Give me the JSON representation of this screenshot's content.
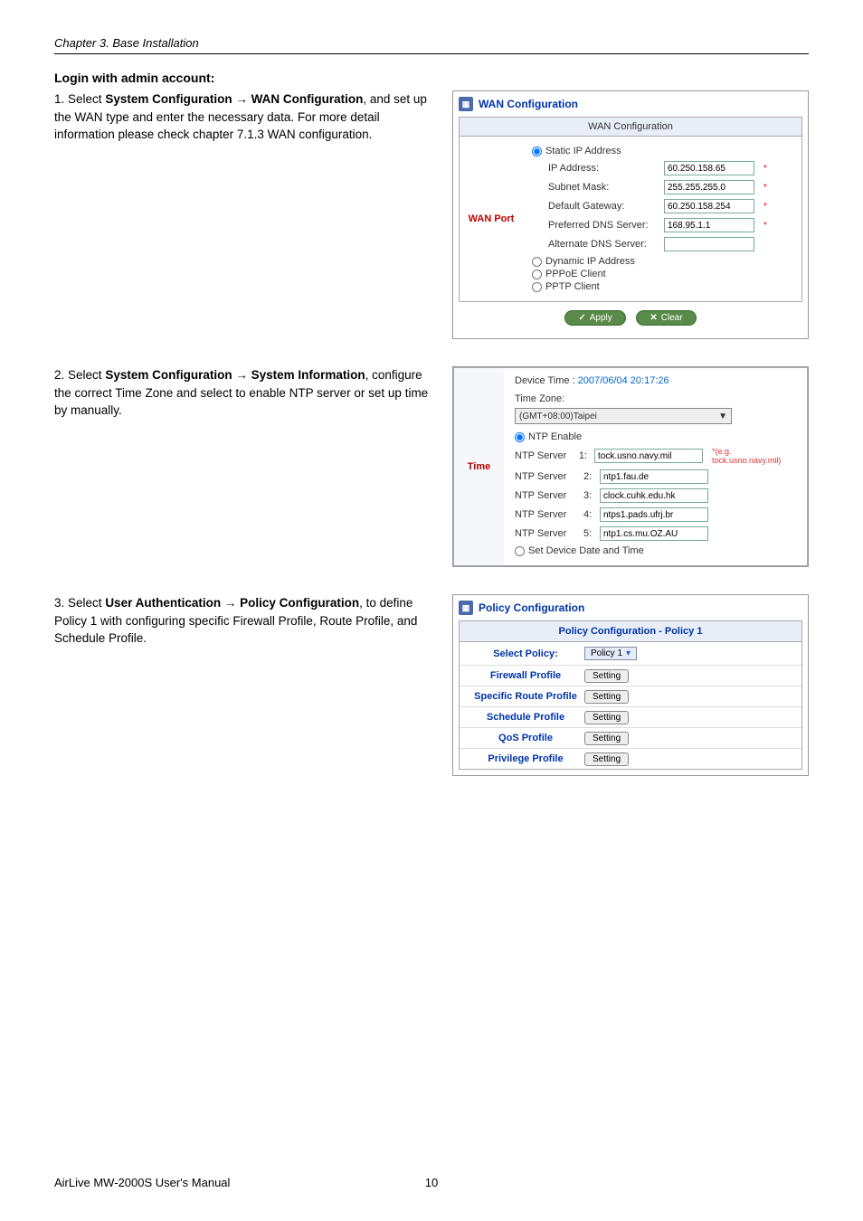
{
  "chapter": "Chapter 3.   Base Installation",
  "login_heading": "Login with admin account:",
  "steps": {
    "s1": {
      "num": "1.",
      "pre": "Select ",
      "bold1": "System Configuration",
      "arrow": " → ",
      "bold2": "WAN Configuration",
      "rest": ", and set up the WAN type and enter the necessary data. For more detail information please check chapter 7.1.3 WAN configuration."
    },
    "s2": {
      "num": "2.",
      "pre": "Select ",
      "bold1": "System Configuration",
      "arrow": " → ",
      "bold2": "System Information",
      "rest": ", configure the correct Time Zone and select to enable NTP server or set up time by manually."
    },
    "s3": {
      "num": "3.",
      "pre": "Select ",
      "bold1": "User Authentication",
      "arrow": " → ",
      "bold2": "Policy Configuration",
      "rest": ", to define Policy 1 with configuring specific Firewall Profile, Route Profile, and Schedule Profile."
    }
  },
  "wan": {
    "panel_title": "WAN Configuration",
    "section_title": "WAN Configuration",
    "port_label": "WAN Port",
    "opt_static": "Static IP Address",
    "opt_dynamic": "Dynamic IP Address",
    "opt_pppoe": "PPPoE Client",
    "opt_pptp": "PPTP Client",
    "f_ip": "IP Address:",
    "f_mask": "Subnet Mask:",
    "f_gw": "Default Gateway:",
    "f_dns1": "Preferred DNS Server:",
    "f_dns2": "Alternate DNS Server:",
    "v_ip": "60.250.158.65",
    "v_mask": "255.255.255.0",
    "v_gw": "60.250.158.254",
    "v_dns1": "168.95.1.1",
    "v_dns2": "",
    "btn_apply": "Apply",
    "btn_clear": "Clear"
  },
  "time": {
    "section_label": "Time",
    "device_time_label": "Device Time : ",
    "device_time_val": "2007/06/04 20:17:26",
    "tz_label": "Time Zone:",
    "tz_value": "(GMT+08:00)Taipei",
    "opt_ntp": "NTP Enable",
    "opt_manual": "Set Device Date and Time",
    "rows": [
      {
        "label": "NTP Server",
        "n": "1:",
        "v": "tock.usno.navy.mil",
        "hint": "*(e.g. tock.usno.navy.mil)"
      },
      {
        "label": "NTP Server",
        "n": "2:",
        "v": "ntp1.fau.de",
        "hint": ""
      },
      {
        "label": "NTP Server",
        "n": "3:",
        "v": "clock.cuhk.edu.hk",
        "hint": ""
      },
      {
        "label": "NTP Server",
        "n": "4:",
        "v": "ntps1.pads.ufrj.br",
        "hint": ""
      },
      {
        "label": "NTP Server",
        "n": "5:",
        "v": "ntp1.cs.mu.OZ.AU",
        "hint": ""
      }
    ]
  },
  "policy": {
    "panel_title": "Policy Configuration",
    "section_title": "Policy Configuration - Policy 1",
    "rows": [
      {
        "label": "Select Policy:",
        "type": "select",
        "val": "Policy 1"
      },
      {
        "label": "Firewall Profile",
        "type": "btn",
        "val": "Setting"
      },
      {
        "label": "Specific Route Profile",
        "type": "btn",
        "val": "Setting"
      },
      {
        "label": "Schedule Profile",
        "type": "btn",
        "val": "Setting"
      },
      {
        "label": "QoS Profile",
        "type": "btn",
        "val": "Setting"
      },
      {
        "label": "Privilege Profile",
        "type": "btn",
        "val": "Setting"
      }
    ]
  },
  "footer": {
    "left": "AirLive MW-2000S User's Manual",
    "page": "10"
  }
}
